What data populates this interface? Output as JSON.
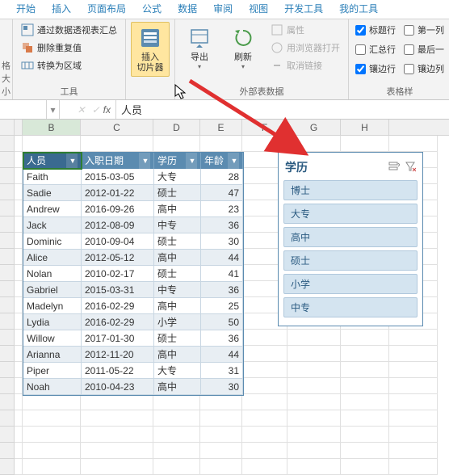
{
  "ribbon": {
    "tabs": [
      "开始",
      "插入",
      "页面布局",
      "公式",
      "数据",
      "审阅",
      "视图",
      "开发工具",
      "我的工具"
    ],
    "group1": {
      "label_top": "格大小",
      "pivot_summary": "通过数据透视表汇总",
      "remove_dupes": "删除重复值",
      "convert_range": "转换为区域",
      "label": "工具"
    },
    "group2": {
      "insert_slicer": "插入\n切片器"
    },
    "group3": {
      "export": "导出",
      "refresh": "刷新",
      "properties": "属性",
      "open_browser": "用浏览器打开",
      "unlink": "取消链接",
      "label": "外部表数据"
    },
    "group4": {
      "header_row": "标题行",
      "total_row": "汇总行",
      "banded_rows": "镶边行",
      "first_col": "第一列",
      "last_col": "最后一",
      "banded_cols": "镶边列",
      "label": "表格样"
    }
  },
  "formula_bar": {
    "value": "人员"
  },
  "columns": [
    "",
    "B",
    "C",
    "D",
    "E",
    "F",
    "G",
    "H"
  ],
  "table": {
    "headers": [
      "人员",
      "入职日期",
      "学历",
      "年龄"
    ],
    "rows": [
      [
        "Faith",
        "2015-03-05",
        "大专",
        "28"
      ],
      [
        "Sadie",
        "2012-01-22",
        "硕士",
        "47"
      ],
      [
        "Andrew",
        "2016-09-26",
        "高中",
        "23"
      ],
      [
        "Jack",
        "2012-08-09",
        "中专",
        "36"
      ],
      [
        "Dominic",
        "2010-09-04",
        "硕士",
        "30"
      ],
      [
        "Alice",
        "2012-05-12",
        "高中",
        "44"
      ],
      [
        "Nolan",
        "2010-02-17",
        "硕士",
        "41"
      ],
      [
        "Gabriel",
        "2015-03-31",
        "中专",
        "36"
      ],
      [
        "Madelyn",
        "2016-02-29",
        "高中",
        "25"
      ],
      [
        "Lydia",
        "2016-02-29",
        "小学",
        "50"
      ],
      [
        "Willow",
        "2017-01-30",
        "硕士",
        "36"
      ],
      [
        "Arianna",
        "2012-11-20",
        "高中",
        "44"
      ],
      [
        "Piper",
        "2011-05-22",
        "大专",
        "31"
      ],
      [
        "Noah",
        "2010-04-23",
        "高中",
        "30"
      ]
    ]
  },
  "slicer": {
    "title": "学历",
    "items": [
      "博士",
      "大专",
      "高中",
      "硕士",
      "小学",
      "中专"
    ]
  }
}
